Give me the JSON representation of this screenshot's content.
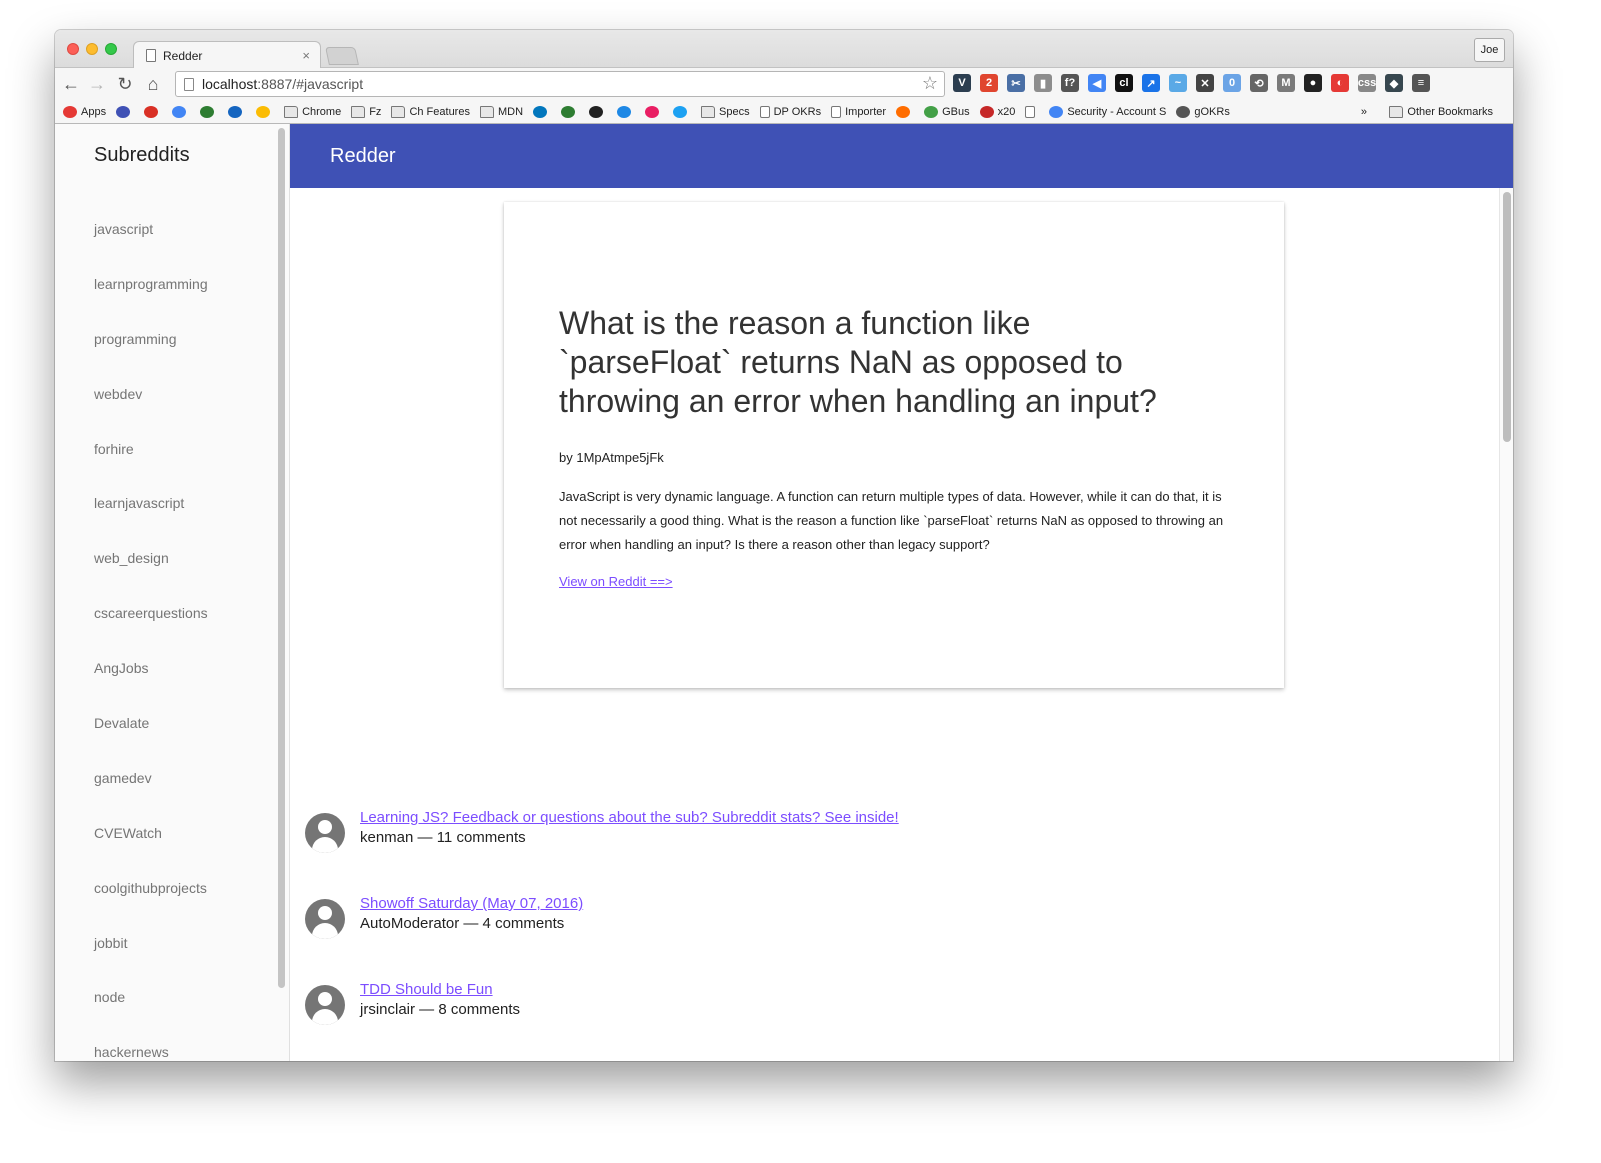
{
  "browser": {
    "tab_title": "Redder",
    "tab_close": "×",
    "profile_name": "Joe",
    "url_host": "localhost",
    "url_rest": ":8887/#javascript",
    "nav": {
      "back": "←",
      "forward": "→",
      "reload": "↻",
      "home": "⌂"
    },
    "star": "☆",
    "extensions": [
      {
        "name": "vivaldi-extension-icon",
        "label": "V",
        "color": "#2c3e50"
      },
      {
        "name": "badge-2-extension-icon",
        "label": "2",
        "color": "#e0452f"
      },
      {
        "name": "scissors-extension-icon",
        "label": "✂",
        "color": "#4a6fa5"
      },
      {
        "name": "columns-extension-icon",
        "label": "▮",
        "color": "#8d8d8d"
      },
      {
        "name": "function-extension-icon",
        "label": "f?",
        "color": "#555555"
      },
      {
        "name": "megaphone-extension-icon",
        "label": "◀",
        "color": "#4285f4"
      },
      {
        "name": "cl-extension-icon",
        "label": "cl",
        "color": "#111111"
      },
      {
        "name": "arrow-extension-icon",
        "label": "↗",
        "color": "#1a73e8"
      },
      {
        "name": "pulse-extension-icon",
        "label": "~",
        "color": "#5aa9e6"
      },
      {
        "name": "close-circle-extension-icon",
        "label": "✕",
        "color": "#444444"
      },
      {
        "name": "ghost-extension-icon",
        "label": "0",
        "color": "#6ba4e6"
      },
      {
        "name": "sync-extension-icon",
        "label": "⟲",
        "color": "#666666"
      },
      {
        "name": "gmail-extension-icon",
        "label": "M",
        "color": "#7a7a7a"
      },
      {
        "name": "github-extension-icon",
        "label": "●",
        "color": "#222222"
      },
      {
        "name": "red-circle-extension-icon",
        "label": "◐",
        "color": "#e53935"
      },
      {
        "name": "css-extension-icon",
        "label": "css",
        "color": "#888888"
      },
      {
        "name": "diamond-extension-icon",
        "label": "◆",
        "color": "#37474f"
      },
      {
        "name": "menu-icon",
        "label": "≡",
        "color": "#555555"
      }
    ],
    "bookmarks": [
      {
        "label": "Apps",
        "icon": "apps",
        "color": "#e53935"
      },
      {
        "label": "",
        "icon": "color",
        "color": "#3f51b5"
      },
      {
        "label": "",
        "icon": "color",
        "color": "#d93025"
      },
      {
        "label": "",
        "icon": "color",
        "color": "#4285f4"
      },
      {
        "label": "",
        "icon": "color",
        "color": "#2e7d32"
      },
      {
        "label": "",
        "icon": "color",
        "color": "#1565c0"
      },
      {
        "label": "",
        "icon": "color",
        "color": "#fbbc04"
      },
      {
        "label": "Chrome",
        "icon": "folder",
        "color": ""
      },
      {
        "label": "Fz",
        "icon": "folder",
        "color": ""
      },
      {
        "label": "Ch Features",
        "icon": "folder",
        "color": ""
      },
      {
        "label": "MDN",
        "icon": "folder",
        "color": ""
      },
      {
        "label": "",
        "icon": "color",
        "color": "#0277bd"
      },
      {
        "label": "",
        "icon": "color",
        "color": "#2e7d32"
      },
      {
        "label": "",
        "icon": "color",
        "color": "#222222"
      },
      {
        "label": "",
        "icon": "color",
        "color": "#1e88e5"
      },
      {
        "label": "",
        "icon": "color",
        "color": "#e91e63"
      },
      {
        "label": "",
        "icon": "color",
        "color": "#1da1f2"
      },
      {
        "label": "Specs",
        "icon": "folder",
        "color": ""
      },
      {
        "label": "DP OKRs",
        "icon": "doc",
        "color": ""
      },
      {
        "label": "Importer",
        "icon": "doc",
        "color": ""
      },
      {
        "label": "",
        "icon": "color",
        "color": "#ff6d00"
      },
      {
        "label": "GBus",
        "icon": "color",
        "color": "#43a047"
      },
      {
        "label": "x20",
        "icon": "color",
        "color": "#c62828"
      },
      {
        "label": "",
        "icon": "doc",
        "color": ""
      },
      {
        "label": "Security - Account S",
        "icon": "color",
        "color": "#4285f4"
      },
      {
        "label": "gOKRs",
        "icon": "color",
        "color": "#555555"
      }
    ],
    "bookmarks_more": "»",
    "other_bookmarks": "Other Bookmarks"
  },
  "drawer": {
    "title": "Subreddits",
    "items": [
      "javascript",
      "learnprogramming",
      "programming",
      "webdev",
      "forhire",
      "learnjavascript",
      "web_design",
      "cscareerquestions",
      "AngJobs",
      "Devalate",
      "gamedev",
      "CVEWatch",
      "coolgithubprojects",
      "jobbit",
      "node",
      "hackernews"
    ]
  },
  "appbar": {
    "title": "Redder"
  },
  "featured": {
    "title": "What is the reason a function like `parseFloat` returns NaN as opposed to throwing an error when handling an input?",
    "author": "by 1MpAtmpe5jFk",
    "body": "JavaScript is very dynamic language. A function can return multiple types of data. However, while it can do that, it is not necessarily a good thing. What is the reason a function like `parseFloat` returns NaN as opposed to throwing an error when handling an input? Is there a reason other than legacy support?",
    "link": "View on Reddit ==>"
  },
  "posts": [
    {
      "title": "Learning JS? Feedback or questions about the sub? Subreddit stats? See inside!",
      "meta": "kenman — 11 comments"
    },
    {
      "title": "Showoff Saturday (May 07, 2016)",
      "meta": "AutoModerator — 4 comments"
    },
    {
      "title": "TDD Should be Fun",
      "meta": "jrsinclair — 8 comments"
    }
  ],
  "colors": {
    "appbar": "#3f51b5",
    "link": "#7c4dff"
  }
}
